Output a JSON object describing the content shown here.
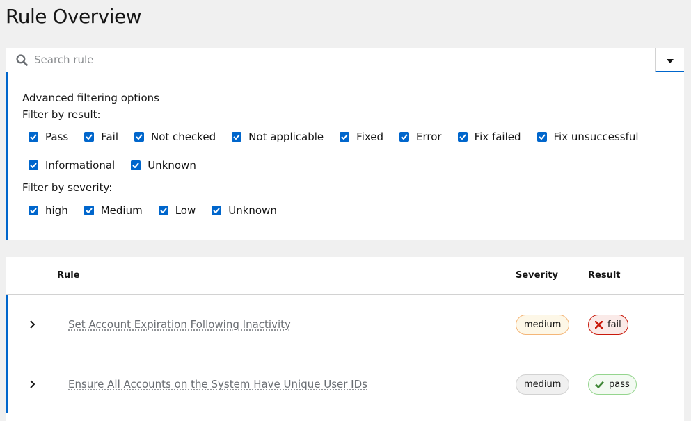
{
  "page": {
    "title": "Rule Overview"
  },
  "search": {
    "placeholder": "Search rule"
  },
  "filters": {
    "heading": "Advanced filtering options",
    "result_label": "Filter by result:",
    "result_options_row1": [
      "Pass",
      "Fail",
      "Not checked",
      "Not applicable",
      "Fixed",
      "Error",
      "Fix failed",
      "Fix unsuccessful"
    ],
    "result_options_row2": [
      "Informational",
      "Unknown"
    ],
    "severity_label": "Filter by severity:",
    "severity_options": [
      "high",
      "Medium",
      "Low",
      "Unknown"
    ]
  },
  "table": {
    "headers": {
      "rule": "Rule",
      "severity": "Severity",
      "result": "Result"
    },
    "rows": [
      {
        "rule": "Set Account Expiration Following Inactivity",
        "severity": "medium",
        "result": "fail"
      },
      {
        "rule": "Ensure All Accounts on the System Have Unique User IDs",
        "severity": "medium",
        "result": "pass"
      }
    ]
  },
  "colors": {
    "accent": "#0066cc",
    "severity_medium_bg": "#fdf7e7",
    "severity_medium_border": "#f4b678",
    "fail_bg": "#faeae8",
    "fail_border": "#c9190b",
    "pass_bg": "#f3faf2",
    "pass_border": "#95d58e"
  }
}
